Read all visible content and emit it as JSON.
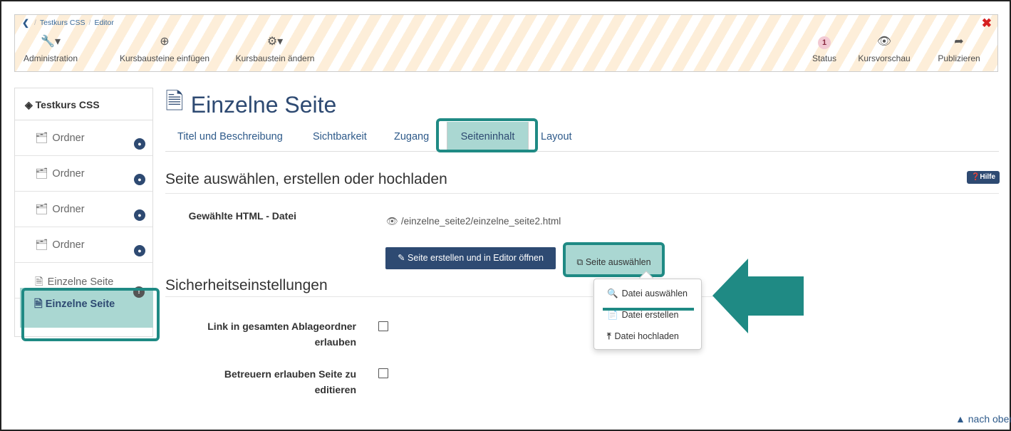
{
  "breadcrumb": {
    "course": "Testkurs CSS",
    "current": "Editor"
  },
  "toolbar": {
    "administration": "Administration",
    "insert": "Kursbausteine einfügen",
    "change": "Kursbaustein ändern",
    "status_count": "1",
    "status": "Status",
    "preview": "Kursvorschau",
    "publish": "Publizieren"
  },
  "sidebar": {
    "title": "Testkurs CSS",
    "items": [
      {
        "label": "Ordner",
        "icon": "folder-icon"
      },
      {
        "label": "Ordner",
        "icon": "folder-icon"
      },
      {
        "label": "Ordner",
        "icon": "folder-icon"
      },
      {
        "label": "Ordner",
        "icon": "folder-icon"
      },
      {
        "label": "Einzelne Seite",
        "icon": "page-icon"
      }
    ],
    "active": "Einzelne Seite"
  },
  "main": {
    "title": "Einzelne Seite",
    "tabs": [
      "Titel und Beschreibung",
      "Sichtbarkeit",
      "Zugang",
      "Seiteninhalt",
      "Layout"
    ],
    "section1": "Seite auswählen, erstellen oder hochladen",
    "help": "Hilfe",
    "file_label": "Gewählte HTML - Datei",
    "file_path": "/einzelne_seite2/einzelne_seite2.html",
    "btn_create": "Seite erstellen und in Editor öffnen",
    "btn_select": "Seite auswählen",
    "dropdown": [
      "Datei auswählen",
      "Datei erstellen",
      "Datei hochladen"
    ],
    "section2": "Sicherheitseinstellungen",
    "opt1_line1": "Link in gesamten Ablageordner",
    "opt1_line2": "erlauben",
    "opt2_line1": "Betreuern erlauben Seite zu",
    "opt2_line2": "editieren",
    "back_to_top": "nach oben"
  },
  "colors": {
    "accent": "#2e4a72",
    "highlight": "#aad7d2",
    "highlight_border": "#1f8a84",
    "close": "#d62020"
  }
}
